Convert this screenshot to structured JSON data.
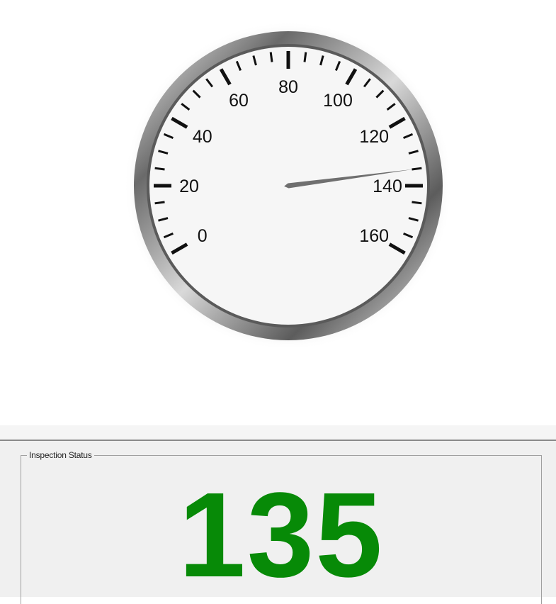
{
  "gauge": {
    "scale_min": 0,
    "scale_max": 160,
    "value": 135,
    "labels": [
      "0",
      "20",
      "40",
      "60",
      "80",
      "100",
      "120",
      "140",
      "160"
    ],
    "needle_color": "#6f6f6f",
    "bezel_color": "#7a7a7a"
  },
  "status": {
    "title": "Inspection Status",
    "value": "135",
    "value_color": "#078a07"
  }
}
